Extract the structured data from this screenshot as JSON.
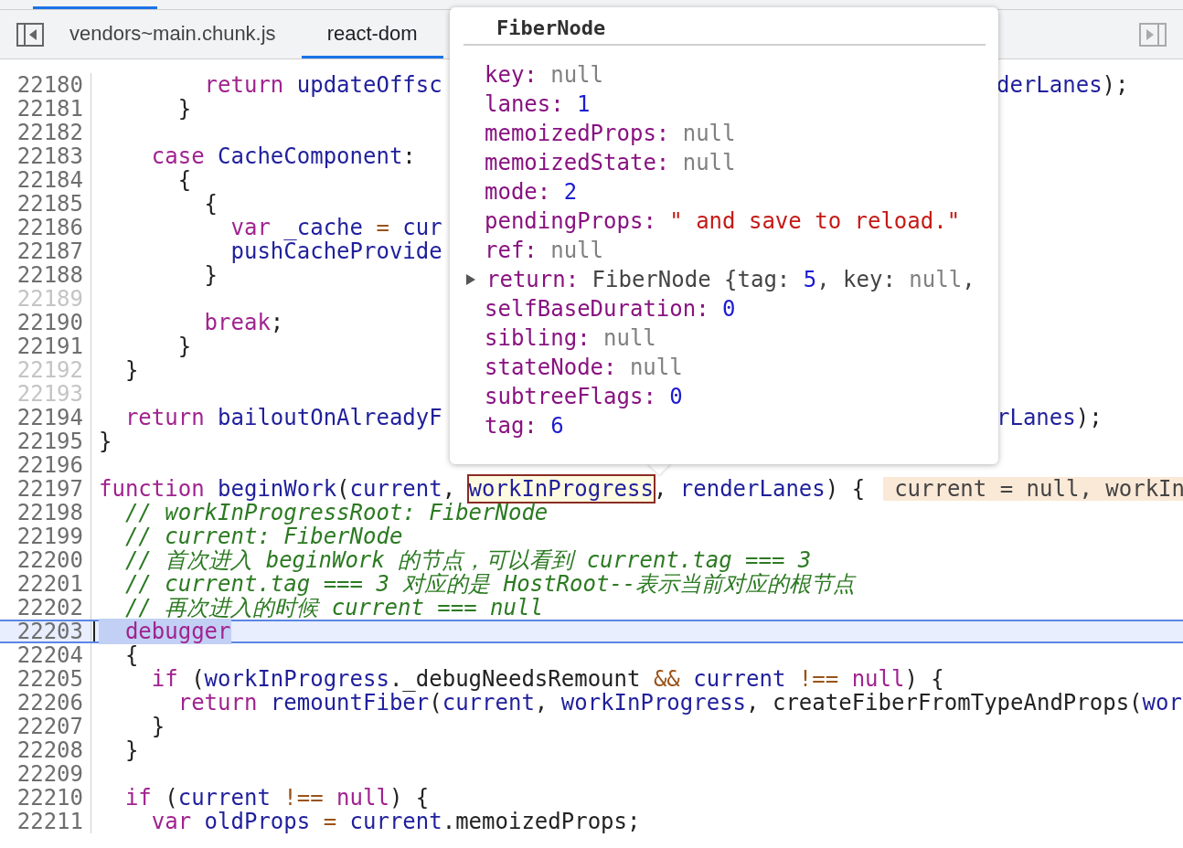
{
  "tabs": [
    {
      "label": "vendors~main.chunk.js",
      "selected": false
    },
    {
      "label": "react-dom",
      "selected": true
    }
  ],
  "lines": [
    {
      "number": "22180",
      "faded": false,
      "paused": false,
      "code": [
        {
          "kind": "keyword",
          "text": "        return"
        },
        {
          "kind": "ident",
          "text": " updateOffsc"
        }
      ],
      "tail": [
        {
          "kind": "ident",
          "text": "derLanes"
        },
        {
          "kind": "plain",
          "text": ");"
        }
      ]
    },
    {
      "number": "22181",
      "faded": false,
      "paused": false,
      "code": [
        {
          "kind": "plain",
          "text": "      }"
        }
      ]
    },
    {
      "number": "22182",
      "faded": false,
      "paused": false
    },
    {
      "number": "22183",
      "faded": false,
      "paused": false,
      "code": [
        {
          "kind": "keyword",
          "text": "    case"
        },
        {
          "kind": "ident",
          "text": " CacheComponent"
        },
        {
          "kind": "plain",
          "text": ":"
        }
      ]
    },
    {
      "number": "22184",
      "faded": false,
      "paused": false,
      "code": [
        {
          "kind": "plain",
          "text": "      {"
        }
      ]
    },
    {
      "number": "22185",
      "faded": false,
      "paused": false,
      "code": [
        {
          "kind": "plain",
          "text": "        {"
        }
      ]
    },
    {
      "number": "22186",
      "faded": false,
      "paused": false,
      "code": [
        {
          "kind": "keyword",
          "text": "          var"
        },
        {
          "kind": "ident",
          "text": " _cache"
        },
        {
          "kind": "operator",
          "text": " ="
        },
        {
          "kind": "ident",
          "text": " cur"
        }
      ]
    },
    {
      "number": "22187",
      "faded": false,
      "paused": false,
      "code": [
        {
          "kind": "ident",
          "text": "          pushCacheProvide"
        }
      ]
    },
    {
      "number": "22188",
      "faded": false,
      "paused": false,
      "code": [
        {
          "kind": "plain",
          "text": "        }"
        }
      ]
    },
    {
      "number": "22189",
      "faded": true,
      "paused": false
    },
    {
      "number": "22190",
      "faded": false,
      "paused": false,
      "code": [
        {
          "kind": "keyword",
          "text": "        break"
        },
        {
          "kind": "plain",
          "text": ";"
        }
      ]
    },
    {
      "number": "22191",
      "faded": false,
      "paused": false,
      "code": [
        {
          "kind": "plain",
          "text": "      }"
        }
      ]
    },
    {
      "number": "22192",
      "faded": true,
      "paused": false,
      "code": [
        {
          "kind": "plain",
          "text": "  }"
        }
      ]
    },
    {
      "number": "22193",
      "faded": true,
      "paused": false
    },
    {
      "number": "22194",
      "faded": false,
      "paused": false,
      "code": [
        {
          "kind": "keyword",
          "text": "  return"
        },
        {
          "kind": "ident",
          "text": " bailoutOnAlreadyF"
        }
      ],
      "tail": [
        {
          "kind": "ident",
          "text": "rLanes"
        },
        {
          "kind": "plain",
          "text": ");"
        }
      ]
    },
    {
      "number": "22195",
      "faded": false,
      "paused": false,
      "code": [
        {
          "kind": "plain",
          "text": "}"
        }
      ]
    },
    {
      "number": "22196",
      "faded": false,
      "paused": false
    },
    {
      "number": "22197",
      "faded": false,
      "paused": false,
      "code": [
        {
          "kind": "keyword",
          "text": "function"
        },
        {
          "kind": "ident",
          "text": " beginWork"
        },
        {
          "kind": "plain",
          "text": "("
        },
        {
          "kind": "ident",
          "text": "current"
        },
        {
          "kind": "plain",
          "text": ", "
        },
        {
          "kind": "hovered",
          "text": "workInProgress"
        },
        {
          "kind": "plain",
          "text": ", "
        },
        {
          "kind": "ident",
          "text": "renderLanes"
        },
        {
          "kind": "plain",
          "text": ") {"
        }
      ],
      "inline_value": "current = null, workIn"
    },
    {
      "number": "22198",
      "faded": false,
      "paused": false,
      "code": [
        {
          "kind": "comment",
          "text": "  // workInProgressRoot: FiberNode"
        }
      ]
    },
    {
      "number": "22199",
      "faded": false,
      "paused": false,
      "code": [
        {
          "kind": "comment",
          "text": "  // current: FiberNode"
        }
      ]
    },
    {
      "number": "22200",
      "faded": false,
      "paused": false,
      "code": [
        {
          "kind": "comment",
          "text": "  // 首次进入 beginWork 的节点，可以看到 current.tag === 3"
        }
      ]
    },
    {
      "number": "22201",
      "faded": false,
      "paused": false,
      "code": [
        {
          "kind": "comment",
          "text": "  // current.tag === 3 对应的是 HostRoot--表示当前对应的根节点"
        }
      ]
    },
    {
      "number": "22202",
      "faded": false,
      "paused": false,
      "code": [
        {
          "kind": "comment",
          "text": "  // 再次进入的时候 current === null"
        }
      ]
    },
    {
      "number": "22203",
      "faded": false,
      "paused": true,
      "code": [
        {
          "kind": "selection",
          "text": "  debugger"
        }
      ]
    },
    {
      "number": "22204",
      "faded": false,
      "paused": false,
      "code": [
        {
          "kind": "plain",
          "text": "  {"
        }
      ]
    },
    {
      "number": "22205",
      "faded": false,
      "paused": false,
      "code": [
        {
          "kind": "keyword",
          "text": "    if"
        },
        {
          "kind": "plain",
          "text": " ("
        },
        {
          "kind": "ident",
          "text": "workInProgress"
        },
        {
          "kind": "plain",
          "text": "._debugNeedsRemount "
        },
        {
          "kind": "operator",
          "text": "&&"
        },
        {
          "kind": "ident",
          "text": " current"
        },
        {
          "kind": "operator",
          "text": " !=="
        },
        {
          "kind": "keyword",
          "text": " null"
        },
        {
          "kind": "plain",
          "text": ") {"
        }
      ]
    },
    {
      "number": "22206",
      "faded": false,
      "paused": false,
      "code": [
        {
          "kind": "keyword",
          "text": "      return"
        },
        {
          "kind": "ident",
          "text": " remountFiber"
        },
        {
          "kind": "plain",
          "text": "("
        },
        {
          "kind": "ident",
          "text": "current"
        },
        {
          "kind": "plain",
          "text": ", "
        },
        {
          "kind": "ident",
          "text": "workInProgress"
        },
        {
          "kind": "plain",
          "text": ", createFiberFromTypeAndProps("
        },
        {
          "kind": "ident",
          "text": "wor"
        }
      ]
    },
    {
      "number": "22207",
      "faded": false,
      "paused": false,
      "code": [
        {
          "kind": "plain",
          "text": "    }"
        }
      ]
    },
    {
      "number": "22208",
      "faded": false,
      "paused": false,
      "code": [
        {
          "kind": "plain",
          "text": "  }"
        }
      ]
    },
    {
      "number": "22209",
      "faded": false,
      "paused": false
    },
    {
      "number": "22210",
      "faded": false,
      "paused": false,
      "code": [
        {
          "kind": "keyword",
          "text": "  if"
        },
        {
          "kind": "plain",
          "text": " ("
        },
        {
          "kind": "ident",
          "text": "current"
        },
        {
          "kind": "operator",
          "text": " !=="
        },
        {
          "kind": "keyword",
          "text": " null"
        },
        {
          "kind": "plain",
          "text": ") {"
        }
      ]
    },
    {
      "number": "22211",
      "faded": false,
      "paused": false,
      "code": [
        {
          "kind": "keyword",
          "text": "    var"
        },
        {
          "kind": "ident",
          "text": " oldProps"
        },
        {
          "kind": "operator",
          "text": " ="
        },
        {
          "kind": "ident",
          "text": " current"
        },
        {
          "kind": "plain",
          "text": ".memoizedProps;"
        }
      ]
    }
  ],
  "popover": {
    "title": "FiberNode",
    "properties": [
      {
        "kind": "value",
        "key": "key:",
        "value": [
          {
            "kind": "null",
            "text": "null"
          }
        ]
      },
      {
        "kind": "value",
        "key": "lanes:",
        "value": [
          {
            "kind": "number",
            "text": "1"
          }
        ]
      },
      {
        "kind": "value",
        "key": "memoizedProps:",
        "value": [
          {
            "kind": "null",
            "text": "null"
          }
        ]
      },
      {
        "kind": "value",
        "key": "memoizedState:",
        "value": [
          {
            "kind": "null",
            "text": "null"
          }
        ]
      },
      {
        "kind": "value",
        "key": "mode:",
        "value": [
          {
            "kind": "number",
            "text": "2"
          }
        ]
      },
      {
        "kind": "value",
        "key": "pendingProps:",
        "value": [
          {
            "kind": "string",
            "text": "\" and save to reload.\""
          }
        ]
      },
      {
        "kind": "value",
        "key": "ref:",
        "value": [
          {
            "kind": "null",
            "text": "null"
          }
        ]
      },
      {
        "kind": "object",
        "key": "return:",
        "value": [
          {
            "kind": "plain",
            "text": "FiberNode {tag: "
          },
          {
            "kind": "number",
            "text": "5"
          },
          {
            "kind": "plain",
            "text": ", key: "
          },
          {
            "kind": "null",
            "text": "null"
          },
          {
            "kind": "plain",
            "text": ","
          }
        ]
      },
      {
        "kind": "value",
        "key": "selfBaseDuration:",
        "value": [
          {
            "kind": "number",
            "text": "0"
          }
        ]
      },
      {
        "kind": "value",
        "key": "sibling:",
        "value": [
          {
            "kind": "null",
            "text": "null"
          }
        ]
      },
      {
        "kind": "value",
        "key": "stateNode:",
        "value": [
          {
            "kind": "null",
            "text": "null"
          }
        ]
      },
      {
        "kind": "value",
        "key": "subtreeFlags:",
        "value": [
          {
            "kind": "number",
            "text": "0"
          }
        ]
      },
      {
        "kind": "value",
        "key": "tag:",
        "value": [
          {
            "kind": "number",
            "text": "6"
          }
        ]
      }
    ]
  }
}
